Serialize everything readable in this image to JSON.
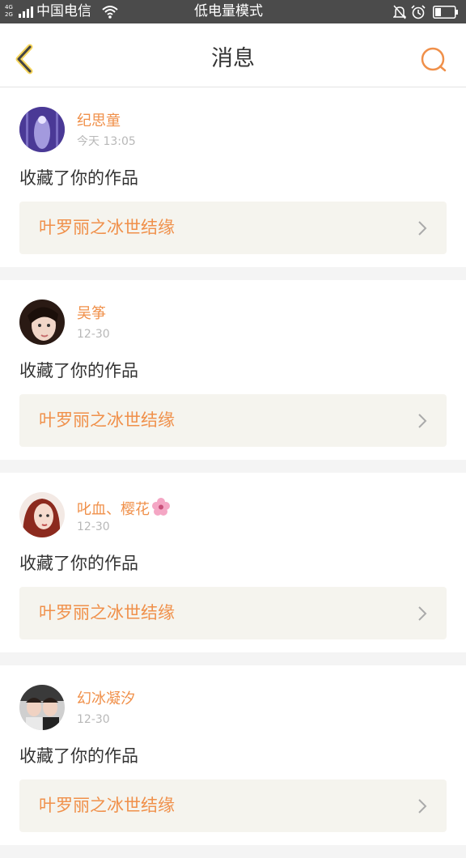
{
  "status_bar": {
    "network_top": "4G",
    "network_bottom": "2G",
    "carrier": "中国电信",
    "mode": "低电量模式",
    "icons": [
      "signal-icon",
      "wifi-icon",
      "bell-off-icon",
      "alarm-icon",
      "battery-icon"
    ]
  },
  "nav": {
    "title": "消息",
    "back_icon": "back-icon",
    "search_icon": "search-icon",
    "accent_color": "#f0904a"
  },
  "messages": [
    {
      "user": "纪思童",
      "time": "今天 13:05",
      "action": "收藏了你的作品",
      "work": "叶罗丽之冰世结缘"
    },
    {
      "user": "吴筝",
      "time": "12-30",
      "action": "收藏了你的作品",
      "work": "叶罗丽之冰世结缘"
    },
    {
      "user": "叱血、樱花",
      "time": "12-30",
      "action": "收藏了你的作品",
      "work": "叶罗丽之冰世结缘",
      "user_icon": "cherry-blossom-icon"
    },
    {
      "user": "幻冰凝汐",
      "time": "12-30",
      "action": "收藏了你的作品",
      "work": "叶罗丽之冰世结缘"
    }
  ]
}
